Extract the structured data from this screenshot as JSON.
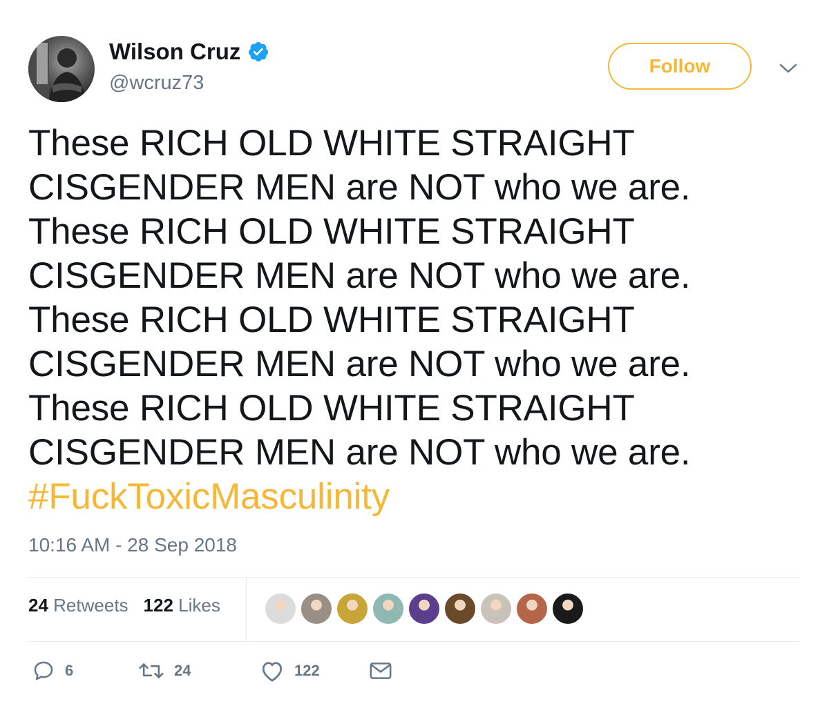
{
  "user": {
    "name": "Wilson Cruz",
    "handle": "@wcruz73",
    "verified": true,
    "avatar_icon": "profile-photo"
  },
  "follow_button": {
    "label": "Follow"
  },
  "menu_icon": "chevron-down-icon",
  "tweet": {
    "lines": [
      "These RICH OLD WHITE STRAIGHT",
      "CISGENDER MEN are NOT who we are.",
      "These RICH OLD WHITE STRAIGHT",
      "CISGENDER MEN are NOT who we are.",
      "These RICH OLD WHITE STRAIGHT",
      "CISGENDER MEN are NOT who we are.",
      "These RICH OLD WHITE STRAIGHT",
      "CISGENDER MEN are NOT who we are."
    ],
    "hashtag": "#FuckToxicMasculinity",
    "timestamp": "10:16 AM - 28 Sep 2018"
  },
  "stats": {
    "retweets_count": "24",
    "retweets_label": "Retweets",
    "likes_count": "122",
    "likes_label": "Likes"
  },
  "likers": [
    {
      "color": "#dcdcdc"
    },
    {
      "color": "#9a8f84"
    },
    {
      "color": "#c9a437"
    },
    {
      "color": "#8fb8b2"
    },
    {
      "color": "#5b3e8c"
    },
    {
      "color": "#6b4a2a"
    },
    {
      "color": "#c8c2b8"
    },
    {
      "color": "#b5654a"
    },
    {
      "color": "#1a1a1a"
    }
  ],
  "actions": {
    "reply_count": "6",
    "retweet_count": "24",
    "like_count": "122"
  },
  "colors": {
    "accent": "#f5b735",
    "verified": "#1da1f2",
    "muted": "#657786",
    "text": "#14171a",
    "divider": "#e6ecf0"
  }
}
